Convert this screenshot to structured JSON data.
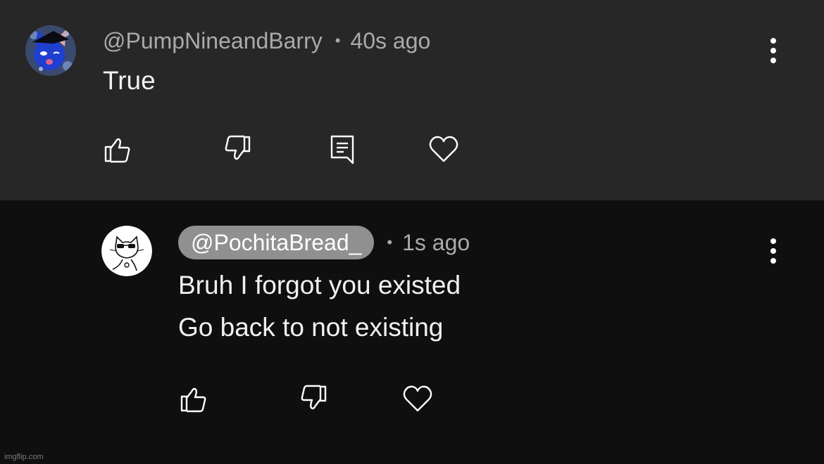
{
  "comments": [
    {
      "handle": "@PumpNineandBarry",
      "separator": "•",
      "time": "40s ago",
      "lines": [
        "True"
      ],
      "avatar_icon": "blue-cat-avatar",
      "actions": [
        "like-icon",
        "dislike-icon",
        "reply-icon",
        "heart-icon"
      ]
    },
    {
      "handle": "@PochitaBread_",
      "separator": "•",
      "time": "1s ago",
      "lines": [
        "Bruh I forgot you existed",
        "Go back to not existing"
      ],
      "avatar_icon": "sunglasses-cat-avatar",
      "actions": [
        "like-icon",
        "dislike-icon",
        "heart-icon"
      ]
    }
  ],
  "watermark": "imgflip.com",
  "colors": {
    "top_bg": "#272727",
    "bottom_bg": "#0f0f0f",
    "meta_text": "#aaaaaa",
    "body_text": "#f1f1f1",
    "pill_bg": "#909090"
  }
}
